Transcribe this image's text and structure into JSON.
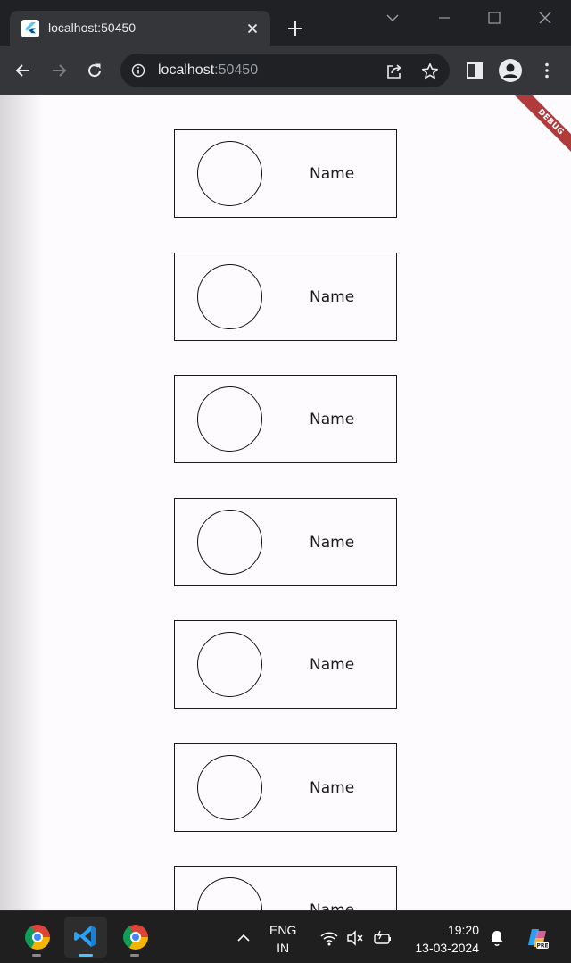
{
  "browser": {
    "tab_title": "localhost:50450",
    "url_host": "localhost",
    "url_port": ":50450",
    "icons": {
      "favicon": "flutter-icon",
      "tab_close": "close-icon",
      "new_tab": "plus-icon",
      "back": "arrow-left-icon",
      "forward": "arrow-right-icon",
      "reload": "reload-icon",
      "site_info": "info-icon",
      "share": "share-icon",
      "bookmark": "star-icon",
      "side_panel": "side-panel-icon",
      "profile": "profile-icon",
      "menu": "kebab-menu-icon"
    }
  },
  "page": {
    "debug_banner": "DEBUG",
    "cards": [
      {
        "name": "Name"
      },
      {
        "name": "Name"
      },
      {
        "name": "Name"
      },
      {
        "name": "Name"
      },
      {
        "name": "Name"
      },
      {
        "name": "Name"
      },
      {
        "name": "Name"
      }
    ]
  },
  "taskbar": {
    "apps": [
      {
        "name": "Google Chrome",
        "icon": "chrome-icon"
      },
      {
        "name": "Visual Studio Code",
        "icon": "vscode-icon",
        "active": true
      },
      {
        "name": "Google Chrome",
        "icon": "chrome-icon"
      }
    ],
    "lang_line1": "ENG",
    "lang_line2": "IN",
    "time": "19:20",
    "date": "13-03-2024",
    "colors": {
      "accent": "#4cc2ff"
    }
  }
}
